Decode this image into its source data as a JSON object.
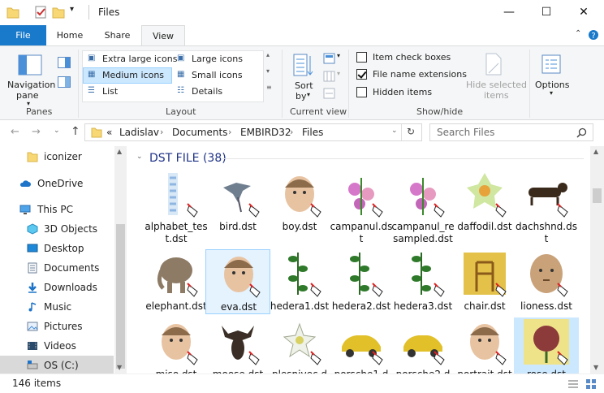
{
  "window": {
    "title": "Files",
    "minimize": "—",
    "maximize": "☐",
    "close": "✕"
  },
  "tabs": [
    {
      "label": "File"
    },
    {
      "label": "Home"
    },
    {
      "label": "Share"
    },
    {
      "label": "View"
    }
  ],
  "ribbon": {
    "panes": {
      "nav_label_1": "Navigation",
      "nav_label_2": "pane",
      "group": "Panes"
    },
    "layout": {
      "options": [
        "Extra large icons",
        "Large icons",
        "Medium icons",
        "Small icons",
        "List",
        "Details"
      ],
      "selected": "Medium icons",
      "group": "Layout"
    },
    "current_view": {
      "sort_1": "Sort",
      "sort_2": "by",
      "group": "Current view"
    },
    "show_hide": {
      "item_check_boxes": "Item check boxes",
      "file_name_extensions": "File name extensions",
      "hidden_items": "Hidden items",
      "hide_selected_1": "Hide selected",
      "hide_selected_2": "items",
      "group": "Show/hide"
    },
    "options": {
      "label": "Options"
    }
  },
  "address": {
    "breadcrumb": [
      "Ladislav",
      "Documents",
      "EMBIRD32",
      "Files"
    ],
    "prefix": "«",
    "search_placeholder": "Search Files"
  },
  "nav": {
    "items": [
      {
        "label": "iconizer"
      },
      {
        "label": "OneDrive"
      },
      {
        "label": "This PC"
      },
      {
        "label": "3D Objects"
      },
      {
        "label": "Desktop"
      },
      {
        "label": "Documents"
      },
      {
        "label": "Downloads"
      },
      {
        "label": "Music"
      },
      {
        "label": "Pictures"
      },
      {
        "label": "Videos"
      },
      {
        "label": "OS (C:)"
      }
    ]
  },
  "content": {
    "group_header": "DST FILE (38)",
    "files": [
      {
        "name": "alphabet_test.dst"
      },
      {
        "name": "bird.dst"
      },
      {
        "name": "boy.dst"
      },
      {
        "name": "campanul.dst"
      },
      {
        "name": "campanul_resampled.dst"
      },
      {
        "name": "daffodil.dst"
      },
      {
        "name": "dachshnd.dst"
      },
      {
        "name": "elephant.dst"
      },
      {
        "name": "eva.dst"
      },
      {
        "name": "hedera1.dst"
      },
      {
        "name": "hedera2.dst"
      },
      {
        "name": "hedera3.dst"
      },
      {
        "name": "chair.dst"
      },
      {
        "name": "lioness.dst"
      },
      {
        "name": "miso.dst"
      },
      {
        "name": "moose.dst"
      },
      {
        "name": "plesnivec.d"
      },
      {
        "name": "porsche1.d"
      },
      {
        "name": "porsche2.d"
      },
      {
        "name": "portrait.dst"
      },
      {
        "name": "rose.dst"
      }
    ]
  },
  "status": {
    "count": "146 items"
  },
  "colors": {
    "accent": "#1979ca",
    "selection": "#cce8ff",
    "header_blue": "#1e3287"
  }
}
